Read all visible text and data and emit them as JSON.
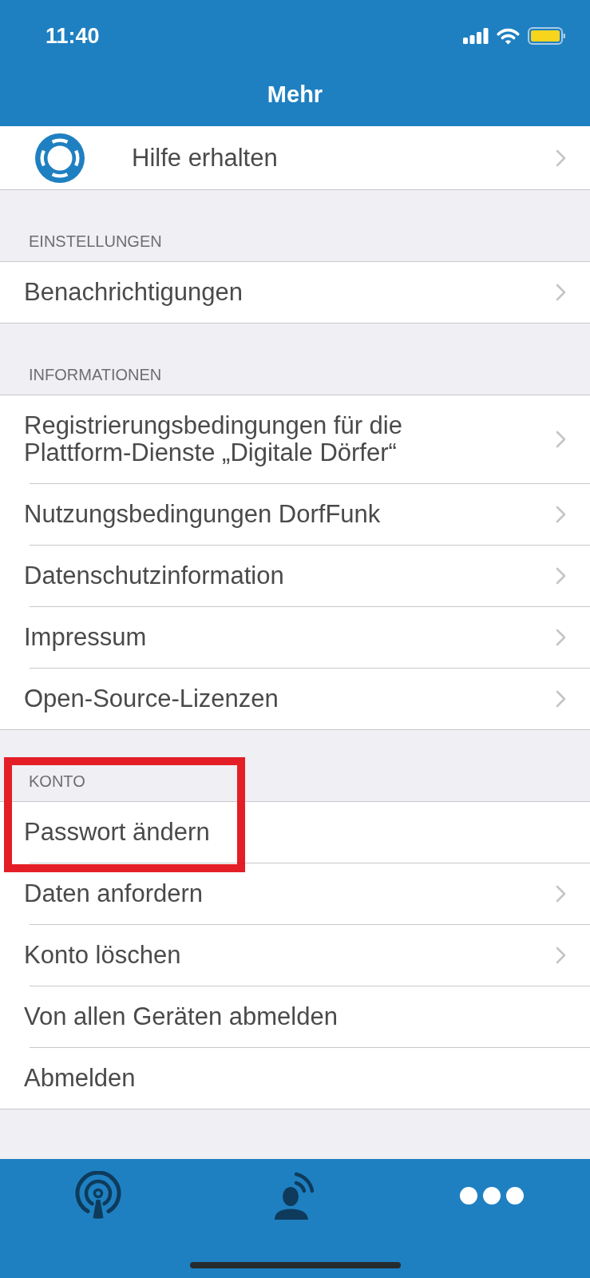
{
  "status_bar": {
    "time": "11:40"
  },
  "nav_bar": {
    "title": "Mehr"
  },
  "help_row": {
    "label": "Hilfe erhalten",
    "chevron": true
  },
  "sections": [
    {
      "title": "EINSTELLUNGEN",
      "highlighted": false,
      "items": [
        {
          "label": "Benachrichtigungen",
          "chevron": true
        }
      ]
    },
    {
      "title": "INFORMATIONEN",
      "highlighted": false,
      "items": [
        {
          "label": "Registrierungsbedingungen für die Plattform-Dienste „Digitale Dörfer“",
          "chevron": true
        },
        {
          "label": "Nutzungsbedingungen DorfFunk",
          "chevron": true
        },
        {
          "label": "Datenschutzinformation",
          "chevron": true
        },
        {
          "label": "Impressum",
          "chevron": true
        },
        {
          "label": "Open-Source-Lizenzen",
          "chevron": true
        }
      ]
    },
    {
      "title": "KONTO",
      "highlighted": true,
      "items": [
        {
          "label": "Passwort ändern",
          "chevron": false
        },
        {
          "label": "Daten anfordern",
          "chevron": true
        },
        {
          "label": "Konto löschen",
          "chevron": true
        },
        {
          "label": "Von allen Geräten abmelden",
          "chevron": false
        },
        {
          "label": "Abmelden",
          "chevron": false
        }
      ]
    }
  ],
  "tab_bar": {
    "tabs": [
      {
        "kind": "broadcast",
        "selected": false
      },
      {
        "kind": "speaker",
        "selected": false
      },
      {
        "kind": "more",
        "selected": true
      }
    ]
  }
}
